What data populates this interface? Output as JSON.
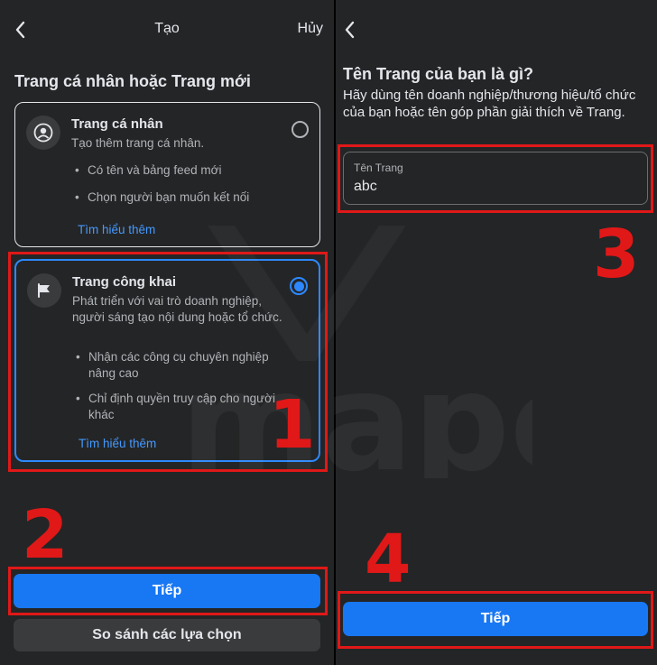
{
  "left": {
    "nav": {
      "title": "Tạo",
      "cancel": "Hủy"
    },
    "heading": "Trang cá nhân hoặc Trang mới",
    "personal": {
      "title": "Trang cá nhân",
      "desc": "Tạo thêm trang cá nhân.",
      "bullets": [
        "Có tên và bảng feed mới",
        "Chọn người bạn muốn kết nối"
      ],
      "learn_more": "Tìm hiểu thêm",
      "selected": false
    },
    "public": {
      "title": "Trang công khai",
      "desc": "Phát triển với vai trò doanh nghiệp, người sáng tạo nội dung hoặc tổ chức.",
      "bullets": [
        "Nhận các công cụ chuyên nghiệp nâng cao",
        "Chỉ định quyền truy cập cho người khác"
      ],
      "learn_more": "Tìm hiểu thêm",
      "selected": true
    },
    "next_button": "Tiếp",
    "compare_button": "So sánh các lựa chọn"
  },
  "right": {
    "heading": "Tên Trang của bạn là gì?",
    "subtext": "Hãy dùng tên doanh nghiệp/thương hiệu/tổ chức của bạn hoặc tên góp phần giải thích về Trang.",
    "input": {
      "label": "Tên Trang",
      "value": "abc"
    },
    "next_button": "Tiếp"
  },
  "annotations": {
    "step1": "1",
    "step2": "2",
    "step3": "3",
    "step4": "4"
  },
  "watermark_text": "mape",
  "colors": {
    "accent": "#1877f2",
    "link": "#4599ff",
    "annotation_red": "#e01818",
    "background": "#242526"
  },
  "icons": [
    "chevron-left-icon",
    "user-circle-icon",
    "flag-icon",
    "radio-empty-icon",
    "radio-selected-icon"
  ]
}
